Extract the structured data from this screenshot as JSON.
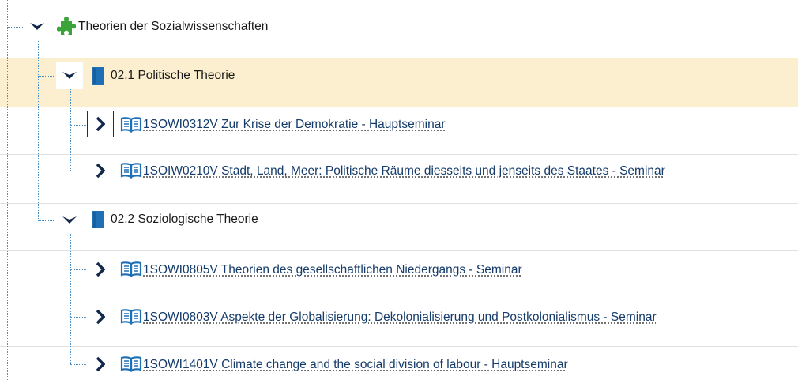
{
  "tree": {
    "root": {
      "label": "Theorien der Sozialwissenschaften",
      "icon": "puzzle-icon",
      "expanded": true
    },
    "groups": [
      {
        "label": "02.1 Politische Theorie",
        "icon": "book-icon",
        "expanded": true,
        "selected": true,
        "courses": [
          {
            "label": "1SOWI0312V Zur Krise der Demokratie - Hauptseminar",
            "icon": "open-book-icon"
          },
          {
            "label": "1SOIW0210V Stadt, Land, Meer: Politische Räume diesseits und jenseits des Staates - Seminar",
            "icon": "open-book-icon"
          }
        ]
      },
      {
        "label": "02.2 Soziologische Theorie",
        "icon": "book-icon",
        "expanded": true,
        "selected": false,
        "courses": [
          {
            "label": "1SOWI0805V Theorien des gesellschaftlichen Niedergangs - Seminar",
            "icon": "open-book-icon"
          },
          {
            "label": "1SOWI0803V Aspekte der Globalisierung: Dekolonialisierung und Postkolonialismus - Seminar",
            "icon": "open-book-icon"
          },
          {
            "label": "1SOWI1401V Climate change and the social division of labour - Hauptseminar",
            "icon": "open-book-icon"
          }
        ]
      }
    ],
    "colors": {
      "selected_row": "#fcefcf",
      "icon_blue": "#1f6fb5",
      "puzzle_green": "#3aa43a",
      "link": "#153b6a",
      "tree_line": "#4a90c8"
    }
  }
}
